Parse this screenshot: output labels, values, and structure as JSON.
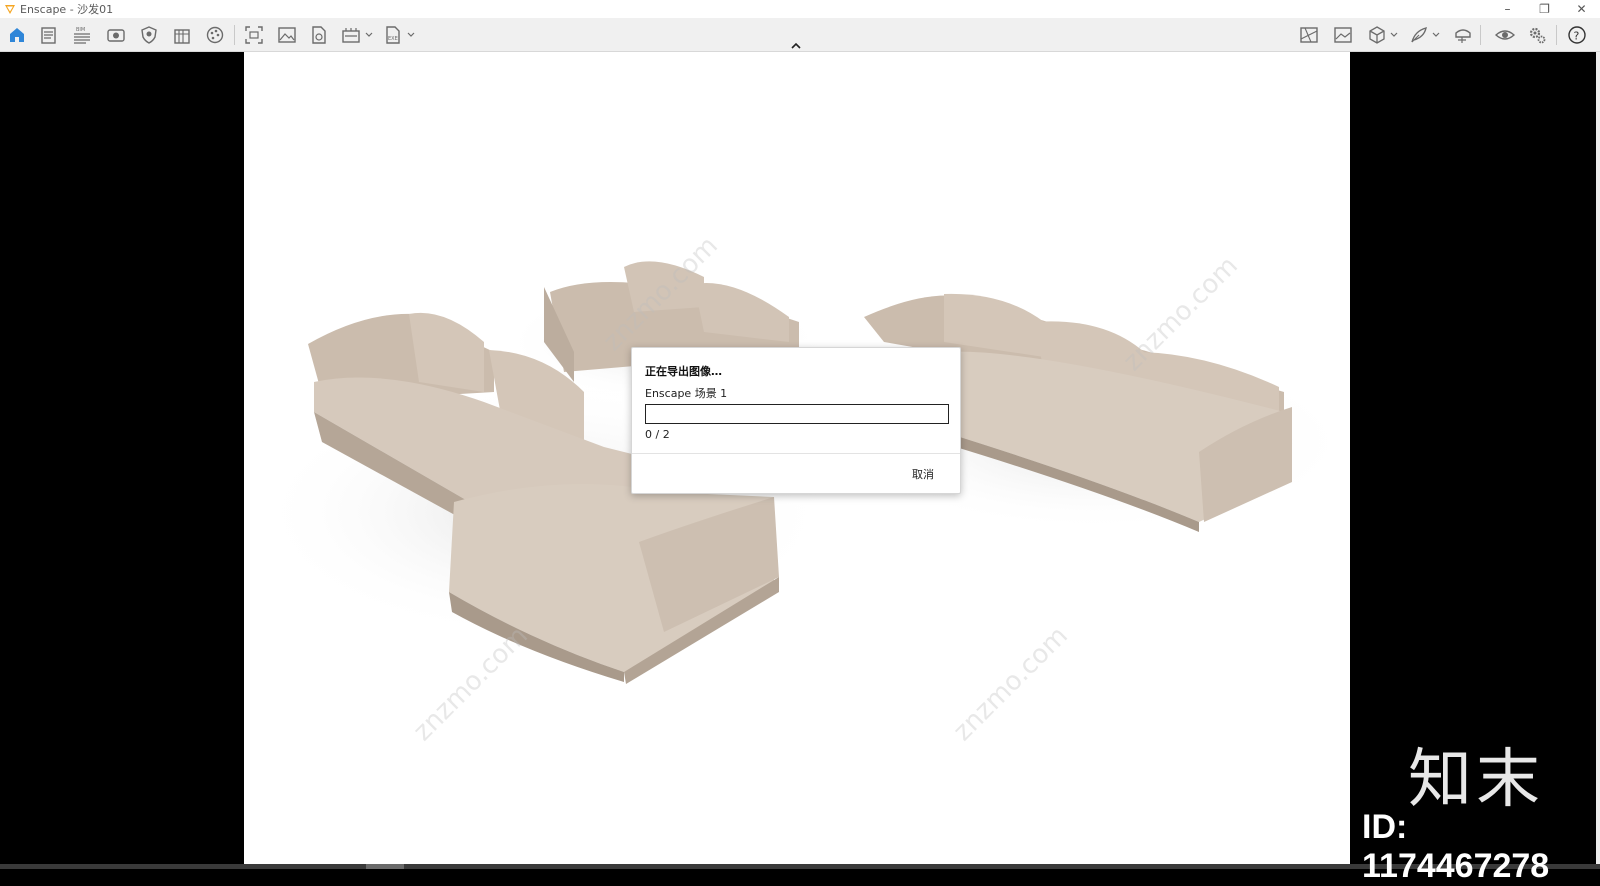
{
  "window": {
    "title": "Enscape - 沙发01",
    "controls": [
      "minimize-icon",
      "restore-icon",
      "close-icon"
    ]
  },
  "toolbar": {
    "left_icons": [
      "home-icon",
      "document-icon",
      "bim-icon",
      "view-icon",
      "shield-icon",
      "building-icon",
      "palette-icon",
      "screenshot-icon",
      "image-icon",
      "file-export-icon",
      "batch-render-icon",
      "exe-export-icon"
    ],
    "right_icons": [
      "map-icon",
      "picture-icon",
      "cube-icon",
      "feather-icon",
      "vr-headset-icon",
      "eye-icon",
      "settings-icon",
      "help-icon"
    ],
    "bim_label": "BIM",
    "exe_label": "EXE",
    "help_label": "?"
  },
  "dialog": {
    "title": "正在导出图像…",
    "scene_label": "Enscape 场景 1",
    "progress_text": "0 / 2",
    "progress_fraction": 0,
    "cancel_label": "取消"
  },
  "watermark": {
    "site": "znzmo.com",
    "logo_text": "知末",
    "id_text": "ID: 1174467278"
  },
  "colors": {
    "accent": "#3b8fe0",
    "sofa": "#cdbfb1",
    "viewport_bg": "#ffffff"
  }
}
